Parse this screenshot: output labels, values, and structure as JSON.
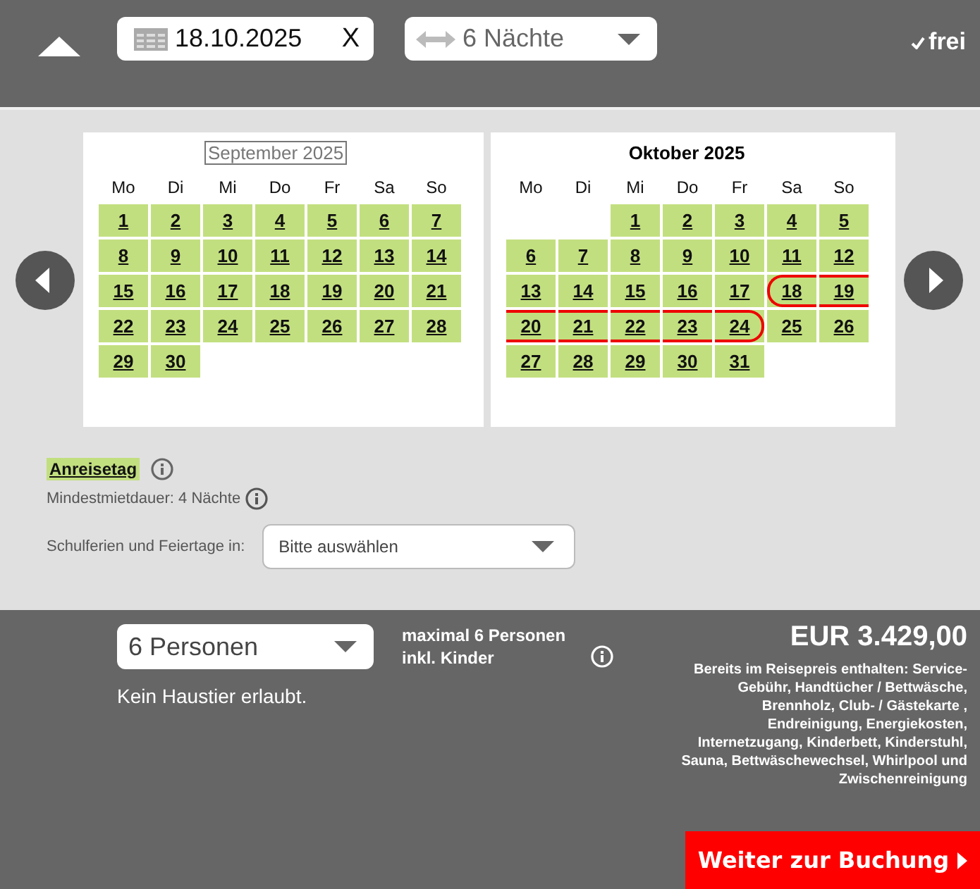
{
  "top_bar": {
    "date_field": {
      "value": "18.10.2025",
      "clear": "X"
    },
    "nights_select": {
      "value": "6 Nächte"
    },
    "availability": {
      "label": "frei"
    }
  },
  "calendar": {
    "months": [
      {
        "title": "September 2025",
        "weekdays": [
          "Mo",
          "Di",
          "Mi",
          "Do",
          "Fr",
          "Sa",
          "So"
        ],
        "weeks": [
          [
            {
              "label": "1",
              "selected": false
            },
            {
              "label": "2",
              "selected": false
            },
            {
              "label": "3",
              "selected": false
            },
            {
              "label": "4",
              "selected": false
            },
            {
              "label": "5",
              "selected": false
            },
            {
              "label": "6",
              "selected": false
            },
            {
              "label": "7",
              "selected": false
            }
          ],
          [
            {
              "label": "8",
              "selected": false
            },
            {
              "label": "9",
              "selected": false
            },
            {
              "label": "10",
              "selected": false
            },
            {
              "label": "11",
              "selected": false
            },
            {
              "label": "12",
              "selected": false
            },
            {
              "label": "13",
              "selected": false
            },
            {
              "label": "14",
              "selected": false
            }
          ],
          [
            {
              "label": "15",
              "selected": false
            },
            {
              "label": "16",
              "selected": false
            },
            {
              "label": "17",
              "selected": false
            },
            {
              "label": "18",
              "selected": false
            },
            {
              "label": "19",
              "selected": false
            },
            {
              "label": "20",
              "selected": false
            },
            {
              "label": "21",
              "selected": false
            }
          ],
          [
            {
              "label": "22",
              "selected": false
            },
            {
              "label": "23",
              "selected": false
            },
            {
              "label": "24",
              "selected": false
            },
            {
              "label": "25",
              "selected": false
            },
            {
              "label": "26",
              "selected": false
            },
            {
              "label": "27",
              "selected": false
            },
            {
              "label": "28",
              "selected": false
            }
          ],
          [
            {
              "label": "29",
              "selected": false
            },
            {
              "label": "30",
              "selected": false
            },
            {
              "kind": "empty"
            },
            {
              "kind": "empty"
            },
            {
              "kind": "empty"
            },
            {
              "kind": "empty"
            },
            {
              "kind": "empty"
            }
          ]
        ]
      },
      {
        "title": "Oktober 2025",
        "weekdays": [
          "Mo",
          "Di",
          "Mi",
          "Do",
          "Fr",
          "Sa",
          "So"
        ],
        "weeks": [
          [
            {
              "kind": "empty"
            },
            {
              "kind": "empty"
            },
            {
              "label": "1",
              "selected": false
            },
            {
              "label": "2",
              "selected": false
            },
            {
              "label": "3",
              "selected": false
            },
            {
              "label": "4",
              "selected": false
            },
            {
              "label": "5",
              "selected": false
            }
          ],
          [
            {
              "label": "6",
              "selected": false
            },
            {
              "label": "7",
              "selected": false
            },
            {
              "label": "8",
              "selected": false
            },
            {
              "label": "9",
              "selected": false
            },
            {
              "label": "10",
              "selected": false
            },
            {
              "label": "11",
              "selected": false
            },
            {
              "label": "12",
              "selected": false
            }
          ],
          [
            {
              "label": "13",
              "selected": false
            },
            {
              "label": "14",
              "selected": false
            },
            {
              "label": "15",
              "selected": false
            },
            {
              "label": "16",
              "selected": false
            },
            {
              "label": "17",
              "selected": false
            },
            {
              "label": "18",
              "selected": true
            },
            {
              "label": "19",
              "selected": true
            }
          ],
          [
            {
              "label": "20",
              "selected": true
            },
            {
              "label": "21",
              "selected": true
            },
            {
              "label": "22",
              "selected": true
            },
            {
              "label": "23",
              "selected": true
            },
            {
              "label": "24",
              "selected": true
            },
            {
              "label": "25",
              "selected": false
            },
            {
              "label": "26",
              "selected": false
            }
          ],
          [
            {
              "label": "27",
              "selected": false
            },
            {
              "label": "28",
              "selected": false
            },
            {
              "label": "29",
              "selected": false
            },
            {
              "label": "30",
              "selected": false
            },
            {
              "label": "31",
              "selected": false
            },
            {
              "kind": "empty"
            },
            {
              "kind": "empty"
            }
          ]
        ]
      }
    ]
  },
  "legend": {
    "arrival_label": "Anreisetag",
    "min_stay": "Mindestmietdauer: 4 Nächte"
  },
  "holidays": {
    "label": "Schulferien und Feiertage in:",
    "select": {
      "value": "Bitte auswählen"
    }
  },
  "booking": {
    "persons_select": {
      "value": "6 Personen"
    },
    "max_persons": "maximal 6 Personen inkl. Kinder",
    "pets": "Kein Haustier erlaubt.",
    "price": "EUR 3.429,00",
    "included": "Bereits im Reisepreis enthalten: Service-Gebühr, Handtücher / Bettwäsche, Brennholz, Club- / Gästekarte , Endreinigung, Energiekosten, Internetzugang, Kinderbett, Kinderstuhl, Sauna, Bettwäschewechsel, Whirlpool und Zwischenreinigung",
    "continue_button": "Weiter zur Buchung"
  }
}
